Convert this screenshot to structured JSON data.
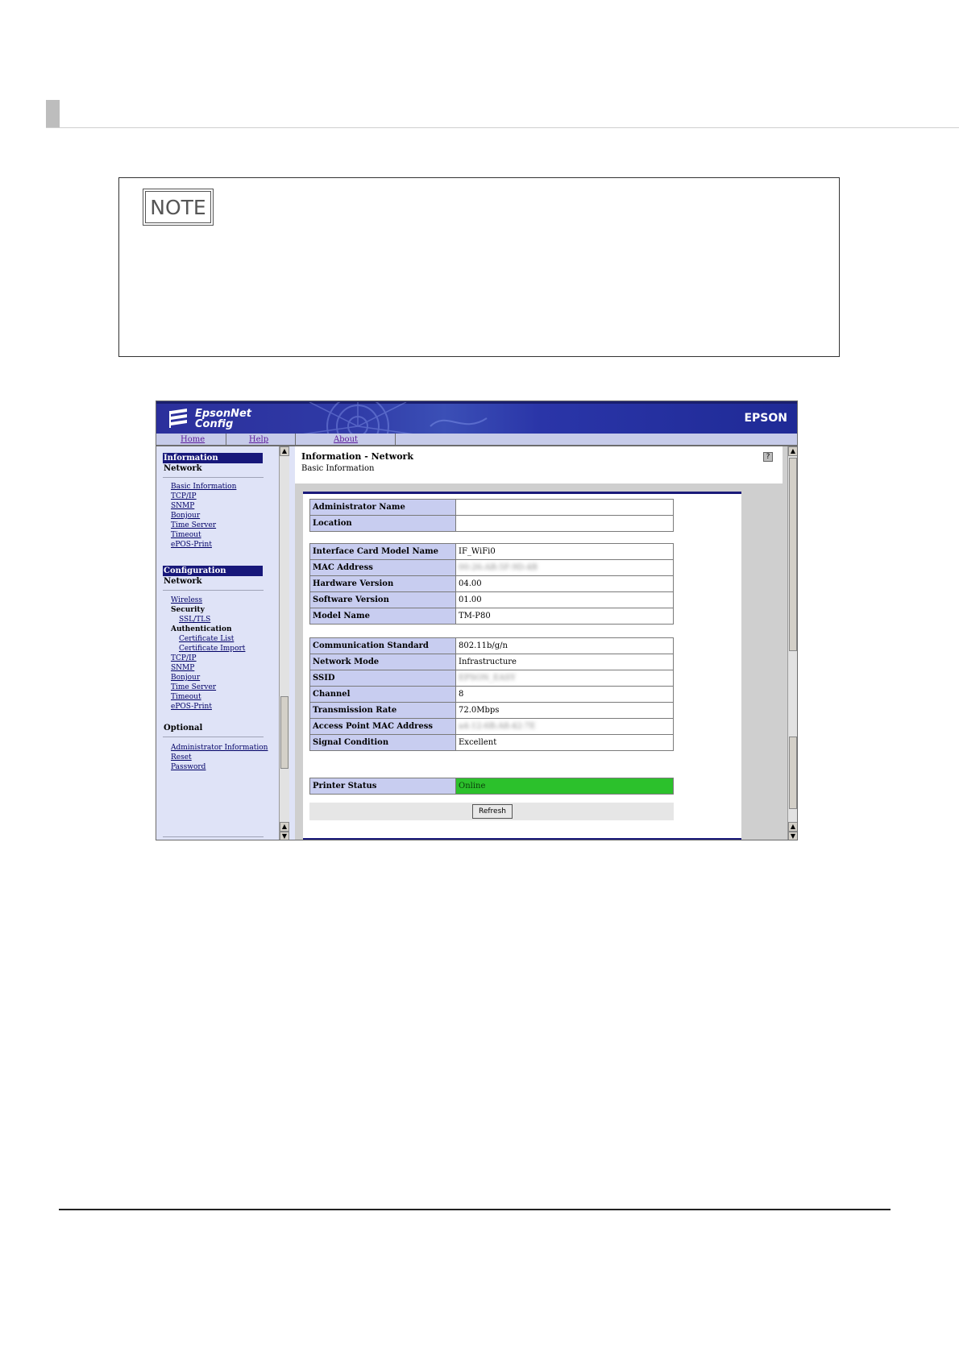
{
  "note": {
    "label": "NOTE"
  },
  "app": {
    "brand_line1": "EpsonNet",
    "brand_line2": "Config",
    "vendor": "EPSON",
    "nav": [
      {
        "label": "Home"
      },
      {
        "label": "Help"
      },
      {
        "label": "About"
      }
    ]
  },
  "sidebar": {
    "information_heading": "Information",
    "information_sub": "Network",
    "information_links": [
      "Basic Information",
      "TCP/IP",
      "SNMP",
      "Bonjour",
      "Time Server",
      "Timeout",
      "ePOS-Print"
    ],
    "configuration_heading": "Configuration",
    "configuration_sub": "Network",
    "config_items": {
      "wireless": "Wireless",
      "security": "Security",
      "ssl_tls": "SSL/TLS",
      "authentication": "Authentication",
      "certificate_list": "Certificate List",
      "certificate_import": "Certificate Import",
      "tcpip": "TCP/IP",
      "snmp": "SNMP",
      "bonjour": "Bonjour",
      "time_server": "Time Server",
      "timeout": "Timeout",
      "epos_print": "ePOS-Print"
    },
    "optional_heading": "Optional",
    "optional_links": [
      "Administrator Information",
      "Reset",
      "Password"
    ]
  },
  "main": {
    "title": "Information - Network",
    "subtitle": "Basic Information",
    "help_icon": "?",
    "admin_table": [
      {
        "label": "Administrator Name",
        "value": ""
      },
      {
        "label": "Location",
        "value": ""
      }
    ],
    "device_table": [
      {
        "label": "Interface Card Model Name",
        "value": "IF_WiFi0"
      },
      {
        "label": "MAC Address",
        "value": "00:26:AB:5F:9D:4B"
      },
      {
        "label": "Hardware Version",
        "value": "04.00"
      },
      {
        "label": "Software Version",
        "value": "01.00"
      },
      {
        "label": "Model Name",
        "value": "TM-P80"
      }
    ],
    "network_table": [
      {
        "label": "Communication Standard",
        "value": "802.11b/g/n"
      },
      {
        "label": "Network Mode",
        "value": "Infrastructure"
      },
      {
        "label": "SSID",
        "value": "EPSON_EASY"
      },
      {
        "label": "Channel",
        "value": "8"
      },
      {
        "label": "Transmission Rate",
        "value": "72.0Mbps"
      },
      {
        "label": "Access Point MAC Address",
        "value": "a4:12:6B:A8:42:7E"
      },
      {
        "label": "Signal Condition",
        "value": "Excellent"
      }
    ],
    "status_table": [
      {
        "label": "Printer Status",
        "value": "Online"
      }
    ],
    "refresh_label": "Refresh"
  },
  "colors": {
    "header_blue": "#2b2f9c",
    "sidebar_heading": "#17177a",
    "label_cell": "#c8cdf0",
    "online_green": "#2cc12c"
  },
  "icons": [
    "epson-logo-icon",
    "help-icon",
    "scroll-up-icon",
    "scroll-down-icon"
  ]
}
